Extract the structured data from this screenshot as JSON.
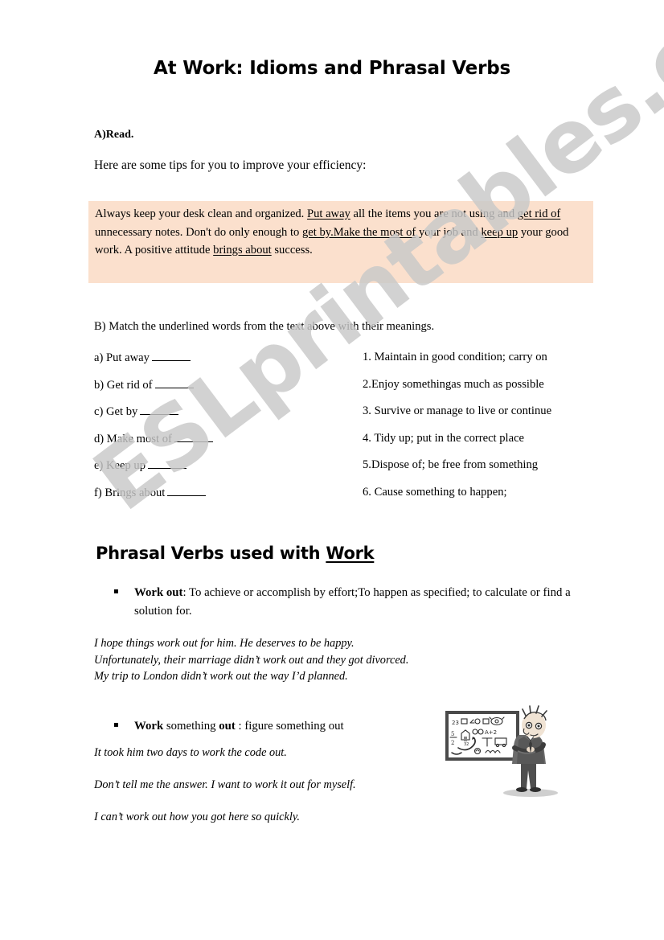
{
  "document": {
    "title": "At Work: Idioms and Phrasal Verbs",
    "watermark": "ESLprintables.com",
    "highlight_color": "#fbe0cd"
  },
  "section_a": {
    "label": "A)Read.",
    "intro": "Here are some tips for you to improve your efficiency:",
    "passage": {
      "part1": "Always keep your desk clean and organized. ",
      "u1": "Put away",
      "part2": " all the items you are not using and ",
      "u2": "get rid of",
      "part3": " unnecessary notes. Don't do only enough to ",
      "u3": "get by.Make the most of",
      "part4": " your job and ",
      "u4": "keep up",
      "part5": " your good work. A positive attitude ",
      "u5": "brings about",
      "part6": " success."
    }
  },
  "section_b": {
    "label": "B) Match the underlined words from the text above with their meanings.",
    "terms": [
      "a) Put away",
      "b) Get rid of",
      "c) Get by",
      "d) Make most of",
      "e) Keep up",
      "f) Brings about"
    ],
    "definitions": [
      "1.  Maintain in good condition; carry on",
      "2.Enjoy somethingas much as possible",
      "3. Survive or manage to live or continue",
      "4. Tidy up; put in the correct place",
      "5.Dispose of; be free from something",
      "6. Cause something to happen;"
    ]
  },
  "section_work": {
    "heading_prefix": "Phrasal Verbs used with ",
    "heading_underlined": "Work",
    "bullet_mark": "▪",
    "entry1": {
      "term": "Work out",
      "definition": ": To achieve or accomplish by effort;To happen as specified; to calculate or find a solution for.",
      "examples": [
        "I hope things work out for him. He deserves to be happy.",
        "Unfortunately, their marriage didn’t work out and they got divorced.",
        "My trip to London didn’t work out the way I’d planned."
      ]
    },
    "entry2": {
      "term_bold1": "Work",
      "term_mid": " something ",
      "term_bold2": "out",
      "definition": " : figure something out",
      "examples": [
        "It took him two days to work the code out.",
        "Don’t tell me the answer. I want to work it out for myself.",
        "I can’t work out how you got here so quickly."
      ]
    }
  },
  "clipart": {
    "name": "man-at-whiteboard-illustration",
    "board_symbols": [
      "23",
      "A+2",
      "5/2",
      "32"
    ]
  }
}
